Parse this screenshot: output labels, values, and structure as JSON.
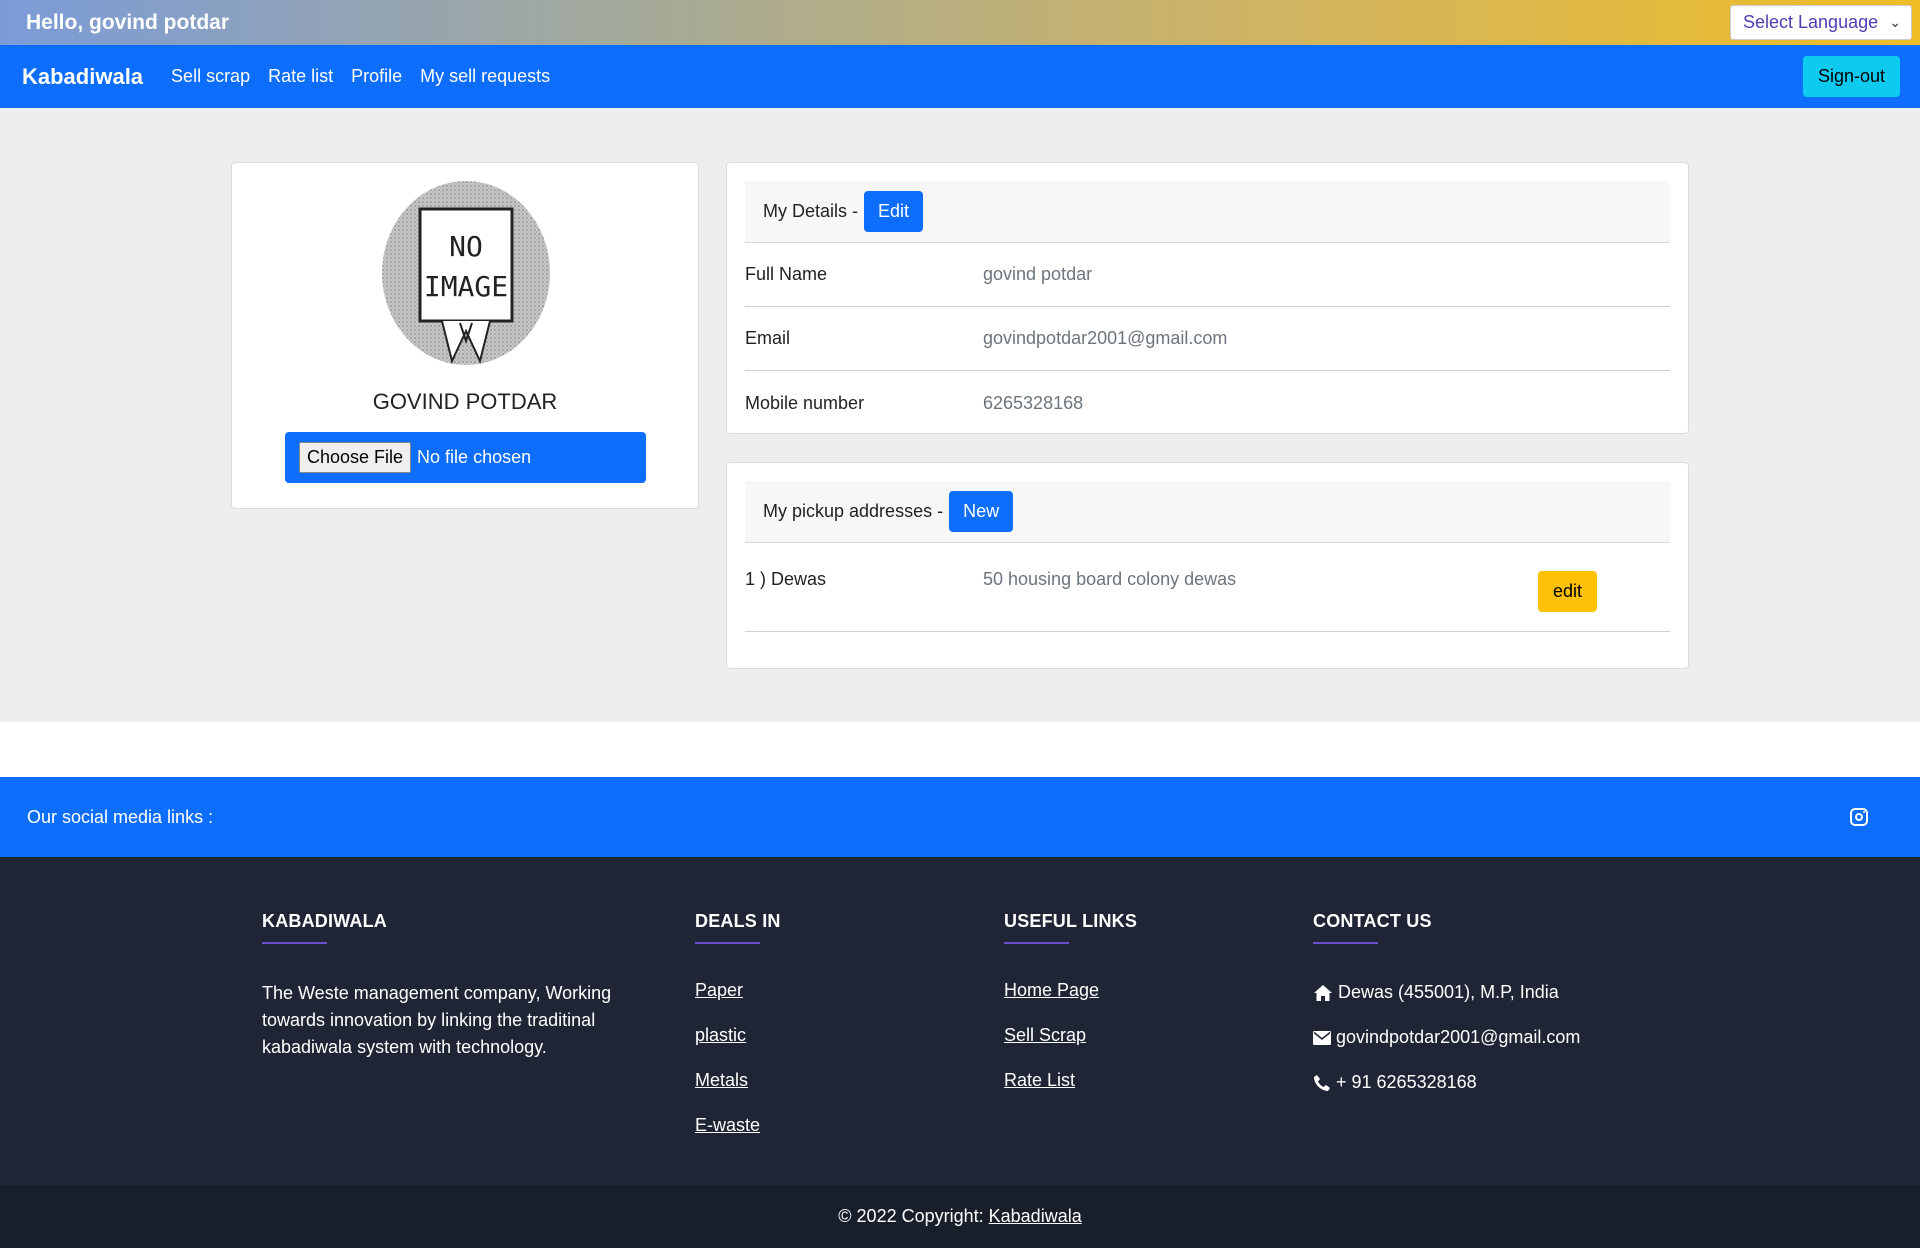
{
  "topbar": {
    "greeting": "Hello, govind potdar",
    "language_select": "Select Language"
  },
  "navbar": {
    "brand": "Kabadiwala",
    "links": [
      "Sell scrap",
      "Rate list",
      "Profile",
      "My sell requests"
    ],
    "signout": "Sign-out"
  },
  "profile": {
    "avatar_text": [
      "NO",
      "IMAGE"
    ],
    "name": "GOVIND POTDAR",
    "file_button": "Choose File",
    "file_status": "No file chosen"
  },
  "details": {
    "heading": "My Details -",
    "edit_button": "Edit",
    "rows": [
      {
        "label": "Full Name",
        "value": "govind potdar"
      },
      {
        "label": "Email",
        "value": "govindpotdar2001@gmail.com"
      },
      {
        "label": "Mobile number",
        "value": "6265328168"
      }
    ]
  },
  "addresses": {
    "heading": "My pickup addresses -",
    "new_button": "New",
    "items": [
      {
        "label": "1 ) Dewas",
        "value": "50 housing board colony dewas",
        "edit": "edit"
      }
    ]
  },
  "social": {
    "label": "Our social media links :",
    "icons": [
      "instagram-icon"
    ]
  },
  "footer": {
    "about": {
      "heading": "KABADIWALA",
      "text": "The Weste management company, Working towards innovation by linking the traditinal kabadiwala system with technology."
    },
    "deals": {
      "heading": "DEALS IN",
      "links": [
        "Paper",
        "plastic",
        "Metals",
        "E-waste"
      ]
    },
    "useful": {
      "heading": "USEFUL LINKS",
      "links": [
        "Home Page",
        "Sell Scrap",
        "Rate List"
      ]
    },
    "contact": {
      "heading": "CONTACT US",
      "address": "Dewas (455001), M.P, India",
      "email": "govindpotdar2001@gmail.com",
      "phone": "+ 91 6265328168"
    }
  },
  "copyright": {
    "text": "© 2022 Copyright:",
    "link": "Kabadiwala"
  },
  "colors": {
    "primary": "#0d6efd",
    "info": "#0dcaf0",
    "warning": "#ffc107",
    "footer": "#1f2535"
  }
}
